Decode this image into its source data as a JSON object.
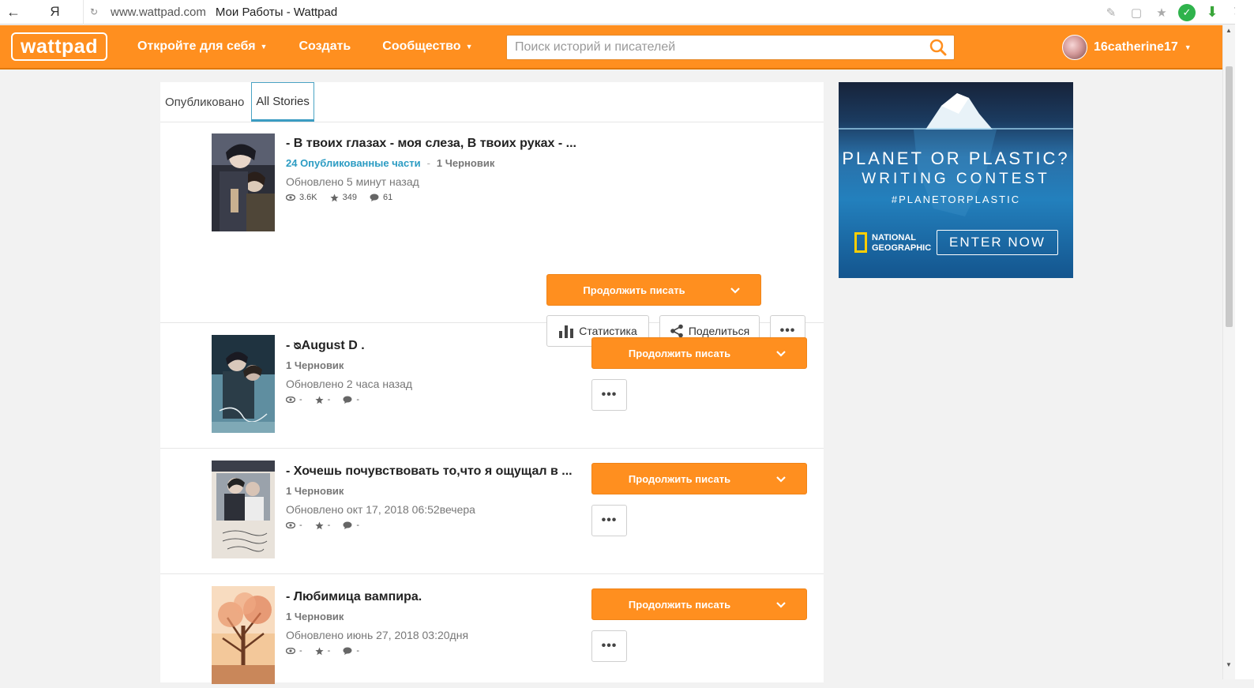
{
  "browser": {
    "domain": "www.wattpad.com",
    "title": "Мои Работы - Wattpad",
    "ya": "Я"
  },
  "header": {
    "logo": "wattpad",
    "nav": [
      {
        "label": "Откройте для себя",
        "caret": true
      },
      {
        "label": "Создать",
        "caret": false
      },
      {
        "label": "Сообщество",
        "caret": true
      }
    ],
    "search_placeholder": "Поиск историй и писателей",
    "username": "16catherine17"
  },
  "tabs": {
    "published": "Опубликовано",
    "all": "All Stories",
    "active": "all"
  },
  "stories": [
    {
      "title": "- В твоих глазах - моя слеза, В твоих руках - ...",
      "published_parts": "24 Опубликованные части",
      "drafts": "1 Черновик",
      "updated": "Обновлено 5 минут назад",
      "views": "3.6K",
      "votes": "349",
      "comments": "61",
      "continue_label": "Продолжить писать",
      "stats_label": "Статистика",
      "share_label": "Поделиться",
      "more_label": "•••"
    },
    {
      "title": "- ᴓAugust D .",
      "drafts": "1 Черновик",
      "updated": "Обновлено 2 часа назад",
      "views": "-",
      "votes": "-",
      "comments": "-",
      "continue_label": "Продолжить писать",
      "more_label": "•••"
    },
    {
      "title": "- Хочешь почувствовать то,что я ощущал в ...",
      "drafts": "1 Черновик",
      "updated": "Обновлено окт 17, 2018 06:52вечера",
      "views": "-",
      "votes": "-",
      "comments": "-",
      "continue_label": "Продолжить писать",
      "more_label": "•••"
    },
    {
      "title": "- Любимица вампира.",
      "drafts": "1 Черновик",
      "updated": "Обновлено июнь 27, 2018 03:20дня",
      "views": "-",
      "votes": "-",
      "comments": "-",
      "continue_label": "Продолжить писать",
      "more_label": "•••"
    }
  ],
  "ad": {
    "line1": "PLANET OR PLASTIC?",
    "line2": "WRITING CONTEST",
    "line3": "#PLANETORPLASTIC",
    "brand": "NATIONAL GEOGRAPHIC",
    "cta": "ENTER NOW"
  },
  "colors": {
    "brand_orange": "#ff8f1f",
    "link_blue": "#2c9cc3"
  }
}
